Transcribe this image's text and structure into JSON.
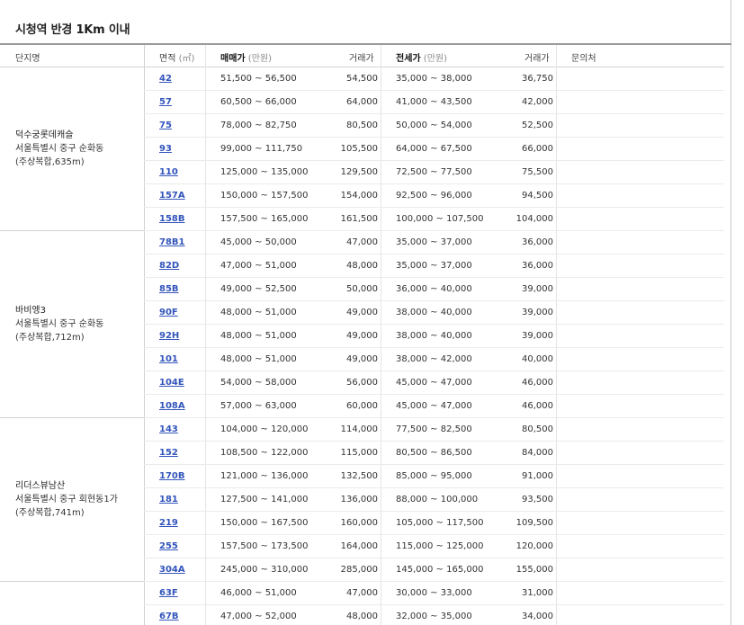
{
  "title": "시청역 반경 1Km 이내",
  "headers": {
    "complex": "단지명",
    "area": "면적",
    "area_unit": "(㎡)",
    "sale": "매매가",
    "sale_unit": "(만원)",
    "sale_tx": "거래가",
    "jeonse": "전세가",
    "jeonse_unit": "(만원)",
    "jeonse_tx": "거래가",
    "contact": "문의처"
  },
  "complexes": [
    {
      "name": "덕수궁롯데캐슬",
      "address": "서울특별시 중구 순화동",
      "detail": "(주상복합,635m)",
      "rows": [
        {
          "area": "42",
          "sale": "51,500 ~ 56,500",
          "sale_tx": "54,500",
          "jeonse": "35,000 ~ 38,000",
          "jeonse_tx": "36,750"
        },
        {
          "area": "57",
          "sale": "60,500 ~ 66,000",
          "sale_tx": "64,000",
          "jeonse": "41,000 ~ 43,500",
          "jeonse_tx": "42,000"
        },
        {
          "area": "75",
          "sale": "78,000 ~ 82,750",
          "sale_tx": "80,500",
          "jeonse": "50,000 ~ 54,000",
          "jeonse_tx": "52,500"
        },
        {
          "area": "93",
          "sale": "99,000 ~ 111,750",
          "sale_tx": "105,500",
          "jeonse": "64,000 ~ 67,500",
          "jeonse_tx": "66,000"
        },
        {
          "area": "110",
          "sale": "125,000 ~ 135,000",
          "sale_tx": "129,500",
          "jeonse": "72,500 ~ 77,500",
          "jeonse_tx": "75,500"
        },
        {
          "area": "157A",
          "sale": "150,000 ~ 157,500",
          "sale_tx": "154,000",
          "jeonse": "92,500 ~ 96,000",
          "jeonse_tx": "94,500"
        },
        {
          "area": "158B",
          "sale": "157,500 ~ 165,000",
          "sale_tx": "161,500",
          "jeonse": "100,000 ~ 107,500",
          "jeonse_tx": "104,000"
        }
      ]
    },
    {
      "name": "바비엥3",
      "address": "서울특별시 중구 순화동",
      "detail": "(주상복합,712m)",
      "rows": [
        {
          "area": "78B1",
          "sale": "45,000 ~ 50,000",
          "sale_tx": "47,000",
          "jeonse": "35,000 ~ 37,000",
          "jeonse_tx": "36,000"
        },
        {
          "area": "82D",
          "sale": "47,000 ~ 51,000",
          "sale_tx": "48,000",
          "jeonse": "35,000 ~ 37,000",
          "jeonse_tx": "36,000"
        },
        {
          "area": "85B",
          "sale": "49,000 ~ 52,500",
          "sale_tx": "50,000",
          "jeonse": "36,000 ~ 40,000",
          "jeonse_tx": "39,000"
        },
        {
          "area": "90F",
          "sale": "48,000 ~ 51,000",
          "sale_tx": "49,000",
          "jeonse": "38,000 ~ 40,000",
          "jeonse_tx": "39,000"
        },
        {
          "area": "92H",
          "sale": "48,000 ~ 51,000",
          "sale_tx": "49,000",
          "jeonse": "38,000 ~ 40,000",
          "jeonse_tx": "39,000"
        },
        {
          "area": "101",
          "sale": "48,000 ~ 51,000",
          "sale_tx": "49,000",
          "jeonse": "38,000 ~ 42,000",
          "jeonse_tx": "40,000"
        },
        {
          "area": "104E",
          "sale": "54,000 ~ 58,000",
          "sale_tx": "56,000",
          "jeonse": "45,000 ~ 47,000",
          "jeonse_tx": "46,000"
        },
        {
          "area": "108A",
          "sale": "57,000 ~ 63,000",
          "sale_tx": "60,000",
          "jeonse": "45,000 ~ 47,000",
          "jeonse_tx": "46,000"
        }
      ]
    },
    {
      "name": "리더스뷰남산",
      "address": "서울특별시 중구 회현동1가",
      "detail": "(주상복합,741m)",
      "rows": [
        {
          "area": "143",
          "sale": "104,000 ~ 120,000",
          "sale_tx": "114,000",
          "jeonse": "77,500 ~ 82,500",
          "jeonse_tx": "80,500"
        },
        {
          "area": "152",
          "sale": "108,500 ~ 122,000",
          "sale_tx": "115,000",
          "jeonse": "80,500 ~ 86,500",
          "jeonse_tx": "84,000"
        },
        {
          "area": "170B",
          "sale": "121,000 ~ 136,000",
          "sale_tx": "132,500",
          "jeonse": "85,000 ~ 95,000",
          "jeonse_tx": "91,000"
        },
        {
          "area": "181",
          "sale": "127,500 ~ 141,000",
          "sale_tx": "136,000",
          "jeonse": "88,000 ~ 100,000",
          "jeonse_tx": "93,500"
        },
        {
          "area": "219",
          "sale": "150,000 ~ 167,500",
          "sale_tx": "160,000",
          "jeonse": "105,000 ~ 117,500",
          "jeonse_tx": "109,500"
        },
        {
          "area": "255",
          "sale": "157,500 ~ 173,500",
          "sale_tx": "164,000",
          "jeonse": "115,000 ~ 125,000",
          "jeonse_tx": "120,000"
        },
        {
          "area": "304A",
          "sale": "245,000 ~ 310,000",
          "sale_tx": "285,000",
          "jeonse": "145,000 ~ 165,000",
          "jeonse_tx": "155,000"
        }
      ]
    },
    {
      "name": "",
      "address": "",
      "detail": "",
      "rows": [
        {
          "area": "63F",
          "sale": "46,000 ~ 51,000",
          "sale_tx": "47,000",
          "jeonse": "30,000 ~ 33,000",
          "jeonse_tx": "31,000"
        },
        {
          "area": "67B",
          "sale": "47,000 ~ 52,000",
          "sale_tx": "48,000",
          "jeonse": "32,000 ~ 35,000",
          "jeonse_tx": "34,000"
        }
      ]
    }
  ]
}
